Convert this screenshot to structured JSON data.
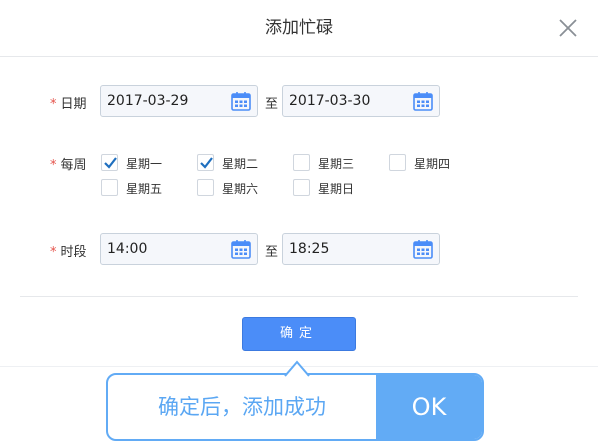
{
  "dialog": {
    "title": "添加忙碌",
    "close_icon": "close-icon"
  },
  "date_row": {
    "required_mark": "*",
    "label": "日期",
    "start_value": "2017-03-29",
    "separator": "至",
    "end_value": "2017-03-30",
    "icon": "calendar-icon"
  },
  "week_row": {
    "required_mark": "*",
    "label": "每周",
    "days": [
      {
        "label": "星期一",
        "checked": true
      },
      {
        "label": "星期二",
        "checked": true
      },
      {
        "label": "星期三",
        "checked": false
      },
      {
        "label": "星期四",
        "checked": false
      },
      {
        "label": "星期五",
        "checked": false
      },
      {
        "label": "星期六",
        "checked": false
      },
      {
        "label": "星期日",
        "checked": false
      }
    ]
  },
  "time_row": {
    "required_mark": "*",
    "label": "时段",
    "start_value": "14:00",
    "separator": "至",
    "end_value": "18:25",
    "icon": "calendar-icon"
  },
  "footer": {
    "confirm_label": "确定"
  },
  "toast": {
    "message": "确定后，添加成功",
    "ok_label": "OK"
  },
  "colors": {
    "accent": "#4b8df8",
    "toast": "#62abf5",
    "required": "#e5534b",
    "check": "#1f6fbf"
  }
}
